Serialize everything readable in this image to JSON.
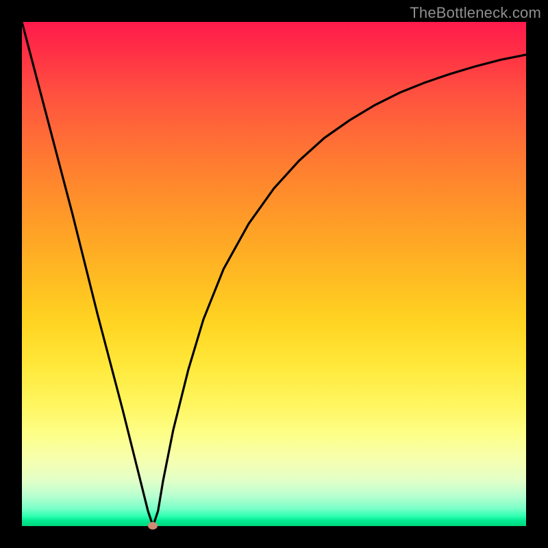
{
  "watermark": "TheBottleneck.com",
  "colors": {
    "frame": "#000000",
    "curve": "#000000",
    "marker": "#cf8a75",
    "gradient_top": "#ff1a4d",
    "gradient_bottom": "#00d67a"
  },
  "chart_data": {
    "type": "line",
    "title": "",
    "xlabel": "",
    "ylabel": "",
    "xlim": [
      0,
      100
    ],
    "ylim": [
      0,
      100
    ],
    "grid": false,
    "legend": false,
    "annotations": [],
    "minimum_marker": {
      "x": 26,
      "y": 0
    },
    "series": [
      {
        "name": "curve",
        "x": [
          0,
          5,
          10,
          15,
          20,
          23,
          25,
          26,
          27,
          28,
          30,
          33,
          36,
          40,
          45,
          50,
          55,
          60,
          65,
          70,
          75,
          80,
          85,
          90,
          95,
          100
        ],
        "y": [
          100,
          81,
          62,
          42,
          23,
          11,
          3,
          0,
          3,
          9,
          19,
          31,
          41,
          51,
          60,
          67,
          72.5,
          77,
          80.5,
          83.5,
          86,
          88,
          89.7,
          91.2,
          92.5,
          93.5
        ]
      }
    ]
  }
}
